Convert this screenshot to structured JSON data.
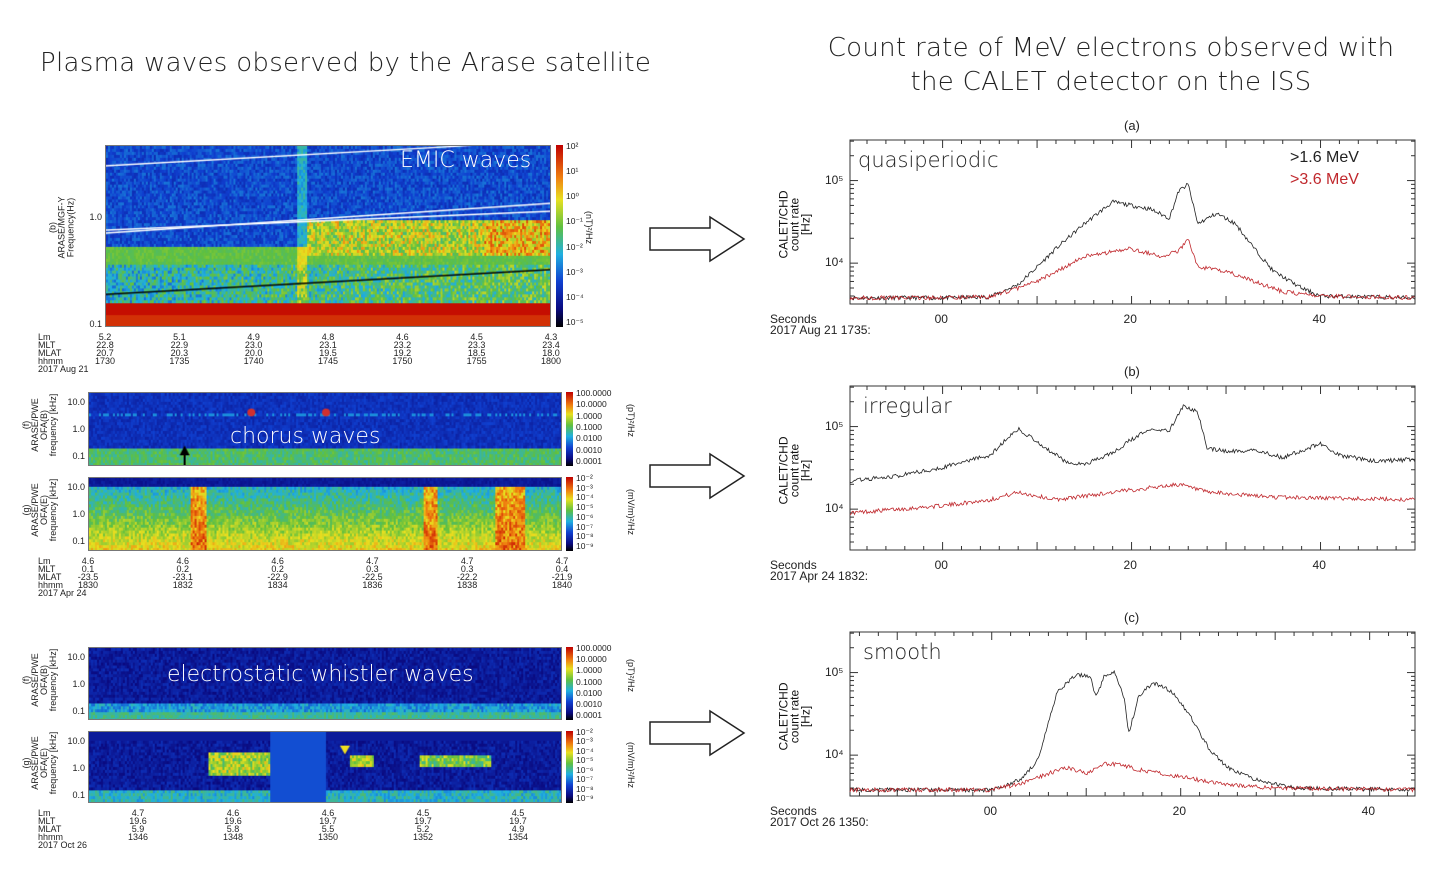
{
  "left_title": "Plasma waves observed by the Arase satellite",
  "right_title_line1": "Count rate of MeV electrons observed with",
  "right_title_line2": "the CALET detector on the ISS",
  "spectrograms": [
    {
      "id": "emic",
      "panel_label": "(b)",
      "ylabel_line1": "ARASE/MGF-Y",
      "ylabel_line2": "Frequency(Hz)",
      "yticks": [
        "1.0",
        "0.1"
      ],
      "overlay_text": "EMIC waves",
      "colorbar_ticks": [
        "10²",
        "10¹",
        "10⁰",
        "10⁻¹",
        "10⁻²",
        "10⁻³",
        "10⁻⁴",
        "10⁻⁵"
      ],
      "colorbar_unit": "(nT)²/Hz",
      "ephemeris": {
        "row_labels": [
          "Lm",
          "MLT",
          "MLAT",
          "hhmm"
        ],
        "date": "2017 Aug 21",
        "columns": [
          [
            "5.2",
            "22.8",
            "20.7",
            "1730"
          ],
          [
            "5.1",
            "22.9",
            "20.3",
            "1735"
          ],
          [
            "4.9",
            "23.0",
            "20.0",
            "1740"
          ],
          [
            "4.8",
            "23.1",
            "19.5",
            "1745"
          ],
          [
            "4.6",
            "23.2",
            "19.2",
            "1750"
          ],
          [
            "4.5",
            "23.3",
            "18.5",
            "1755"
          ],
          [
            "4.3",
            "23.4",
            "18.0",
            "1800"
          ]
        ]
      }
    },
    {
      "id": "chorus-f",
      "panel_label": "(f)",
      "ylabel_line1": "ARASE/PWE",
      "ylabel_line2": "OFA(B)",
      "ylabel_line3": "frequency [kHz]",
      "yticks": [
        "10.0",
        "1.0",
        "0.1"
      ],
      "overlay_text": "chorus waves",
      "colorbar_ticks": [
        "100.0000",
        "10.0000",
        "1.0000",
        "0.1000",
        "0.0100",
        "0.0010",
        "0.0001"
      ],
      "colorbar_unit": "(pT)²/Hz"
    },
    {
      "id": "chorus-g",
      "panel_label": "(g)",
      "ylabel_line1": "ARASE/PWE",
      "ylabel_line2": "OFA(E)",
      "ylabel_line3": "frequency [kHz]",
      "yticks": [
        "10.0",
        "1.0",
        "0.1"
      ],
      "colorbar_ticks": [
        "10⁻²",
        "10⁻³",
        "10⁻⁴",
        "10⁻⁵",
        "10⁻⁶",
        "10⁻⁷",
        "10⁻⁸",
        "10⁻⁹"
      ],
      "colorbar_unit": "(mV/m)²/Hz",
      "ephemeris": {
        "row_labels": [
          "Lm",
          "MLT",
          "MLAT",
          "hhmm"
        ],
        "date": "2017 Apr 24",
        "columns": [
          [
            "4.6",
            "0.1",
            "-23.5",
            "1830"
          ],
          [
            "4.6",
            "0.2",
            "-23.1",
            "1832"
          ],
          [
            "4.6",
            "0.2",
            "-22.9",
            "1834"
          ],
          [
            "4.7",
            "0.3",
            "-22.5",
            "1836"
          ],
          [
            "4.7",
            "0.3",
            "-22.2",
            "1838"
          ],
          [
            "4.7",
            "0.4",
            "-21.9",
            "1840"
          ]
        ]
      }
    },
    {
      "id": "esw-f",
      "panel_label": "(f)",
      "ylabel_line1": "ARASE/PWE",
      "ylabel_line2": "OFA(B)",
      "ylabel_line3": "frequency [kHz]",
      "yticks": [
        "10.0",
        "1.0",
        "0.1"
      ],
      "overlay_text": "electrostatic whistler waves",
      "colorbar_ticks": [
        "100.0000",
        "10.0000",
        "1.0000",
        "0.1000",
        "0.0100",
        "0.0010",
        "0.0001"
      ],
      "colorbar_unit": "(pT)²/Hz"
    },
    {
      "id": "esw-g",
      "panel_label": "(g)",
      "ylabel_line1": "ARASE/PWE",
      "ylabel_line2": "OFA(E)",
      "ylabel_line3": "frequency [kHz]",
      "yticks": [
        "10.0",
        "1.0",
        "0.1"
      ],
      "colorbar_ticks": [
        "10⁻²",
        "10⁻³",
        "10⁻⁴",
        "10⁻⁵",
        "10⁻⁶",
        "10⁻⁷",
        "10⁻⁸",
        "10⁻⁹"
      ],
      "colorbar_unit": "(mV/m)²/Hz",
      "ephemeris": {
        "row_labels": [
          "Lm",
          "MLT",
          "MLAT",
          "hhmm"
        ],
        "date": "2017 Oct 26",
        "columns": [
          [
            "4.7",
            "19.6",
            "5.9",
            "1346"
          ],
          [
            "4.6",
            "19.6",
            "5.8",
            "1348"
          ],
          [
            "4.6",
            "19.7",
            "5.5",
            "1350"
          ],
          [
            "4.5",
            "19.7",
            "5.2",
            "1352"
          ],
          [
            "4.5",
            "19.7",
            "4.9",
            "1354"
          ]
        ]
      }
    }
  ],
  "chart_data": [
    {
      "type": "line",
      "panel": "(a)",
      "annotation": "quasiperiodic",
      "ylabel": "CALET/CHD count rate [Hz]",
      "xlabel": "Seconds",
      "time_origin": "2017 Aug 21 1735:",
      "x_ticks": [
        "00",
        "20",
        "40"
      ],
      "x_tick_values": [
        0,
        20,
        40
      ],
      "xlim": [
        -9.8,
        50
      ],
      "y_scale": "log",
      "y_ticks": [
        "10⁵",
        "10⁴"
      ],
      "y_tick_values": [
        100000,
        10000
      ],
      "ylim": [
        3200,
        310000
      ],
      "legend_placement": "top-right",
      "series": [
        {
          "name": ">1.6 MeV",
          "color": "#222222",
          "x": [
            -9.8,
            0,
            5,
            8,
            10,
            12,
            15,
            18,
            20,
            22,
            24,
            25,
            26,
            27,
            29,
            31,
            33,
            35,
            38,
            40,
            50
          ],
          "y": [
            3800,
            3800,
            3900,
            5500,
            9000,
            15000,
            30000,
            55000,
            50000,
            45000,
            35000,
            75000,
            90000,
            30000,
            40000,
            30000,
            15000,
            8000,
            5000,
            4000,
            3800
          ]
        },
        {
          "name": ">3.6 MeV",
          "color": "#c0282d",
          "x": [
            -9.8,
            0,
            5,
            8,
            10,
            15,
            20,
            23,
            25,
            26,
            27,
            30,
            33,
            36,
            40,
            50
          ],
          "y": [
            3800,
            3800,
            3900,
            5000,
            6000,
            12000,
            15000,
            12000,
            14000,
            20000,
            9000,
            8000,
            6000,
            4500,
            4000,
            3800
          ]
        }
      ]
    },
    {
      "type": "line",
      "panel": "(b)",
      "annotation": "irregular",
      "ylabel": "CALET/CHD count rate [Hz]",
      "xlabel": "Seconds",
      "time_origin": "2017 Apr 24 1832:",
      "x_ticks": [
        "00",
        "20",
        "40"
      ],
      "x_tick_values": [
        0,
        20,
        40
      ],
      "xlim": [
        -9.8,
        50
      ],
      "y_scale": "log",
      "y_ticks": [
        "10⁵",
        "10⁴"
      ],
      "y_tick_values": [
        100000,
        10000
      ],
      "ylim": [
        3200,
        310000
      ],
      "series": [
        {
          "color": "#222222",
          "x": [
            -9.8,
            -5,
            0,
            5,
            8,
            10,
            13,
            15,
            18,
            20,
            22,
            24,
            25.5,
            27,
            28,
            30,
            33,
            36,
            40,
            42,
            46,
            50
          ],
          "y": [
            22000,
            25000,
            32000,
            45000,
            95000,
            65000,
            38000,
            35000,
            48000,
            70000,
            95000,
            90000,
            180000,
            150000,
            55000,
            50000,
            52000,
            42000,
            62000,
            45000,
            38000,
            40000
          ]
        },
        {
          "color": "#c0282d",
          "x": [
            -9.8,
            0,
            5,
            8,
            12,
            18,
            25,
            28,
            35,
            50
          ],
          "y": [
            9000,
            11000,
            13000,
            16000,
            13000,
            16000,
            20000,
            16000,
            14000,
            13000
          ]
        }
      ]
    },
    {
      "type": "line",
      "panel": "(c)",
      "annotation": "smooth",
      "ylabel": "CALET/CHD count rate [Hz]",
      "xlabel": "Seconds",
      "time_origin": "2017 Oct 26 1350:",
      "x_ticks": [
        "00",
        "20",
        "40"
      ],
      "x_tick_values": [
        0,
        20,
        40
      ],
      "xlim": [
        -15,
        44.8
      ],
      "y_scale": "log",
      "y_ticks": [
        "10⁵",
        "10⁴"
      ],
      "y_tick_values": [
        100000,
        10000
      ],
      "ylim": [
        3200,
        310000
      ],
      "series": [
        {
          "color": "#222222",
          "x": [
            -15,
            0,
            3,
            5,
            6,
            7,
            9,
            10.5,
            11,
            12,
            13,
            14,
            14.5,
            15.5,
            17,
            19,
            21,
            23,
            25,
            28,
            32,
            44.8
          ],
          "y": [
            3800,
            3800,
            5000,
            9000,
            25000,
            60000,
            95000,
            90000,
            50000,
            95000,
            100000,
            50000,
            18000,
            50000,
            75000,
            60000,
            30000,
            12000,
            7000,
            5000,
            4000,
            3800
          ]
        },
        {
          "color": "#c0282d",
          "x": [
            -15,
            0,
            3,
            6,
            8,
            10,
            12,
            14,
            16,
            20,
            24,
            30,
            44.8
          ],
          "y": [
            3800,
            3800,
            4500,
            6000,
            7000,
            6000,
            8000,
            7500,
            6500,
            5500,
            4500,
            4000,
            3800
          ]
        }
      ]
    }
  ]
}
